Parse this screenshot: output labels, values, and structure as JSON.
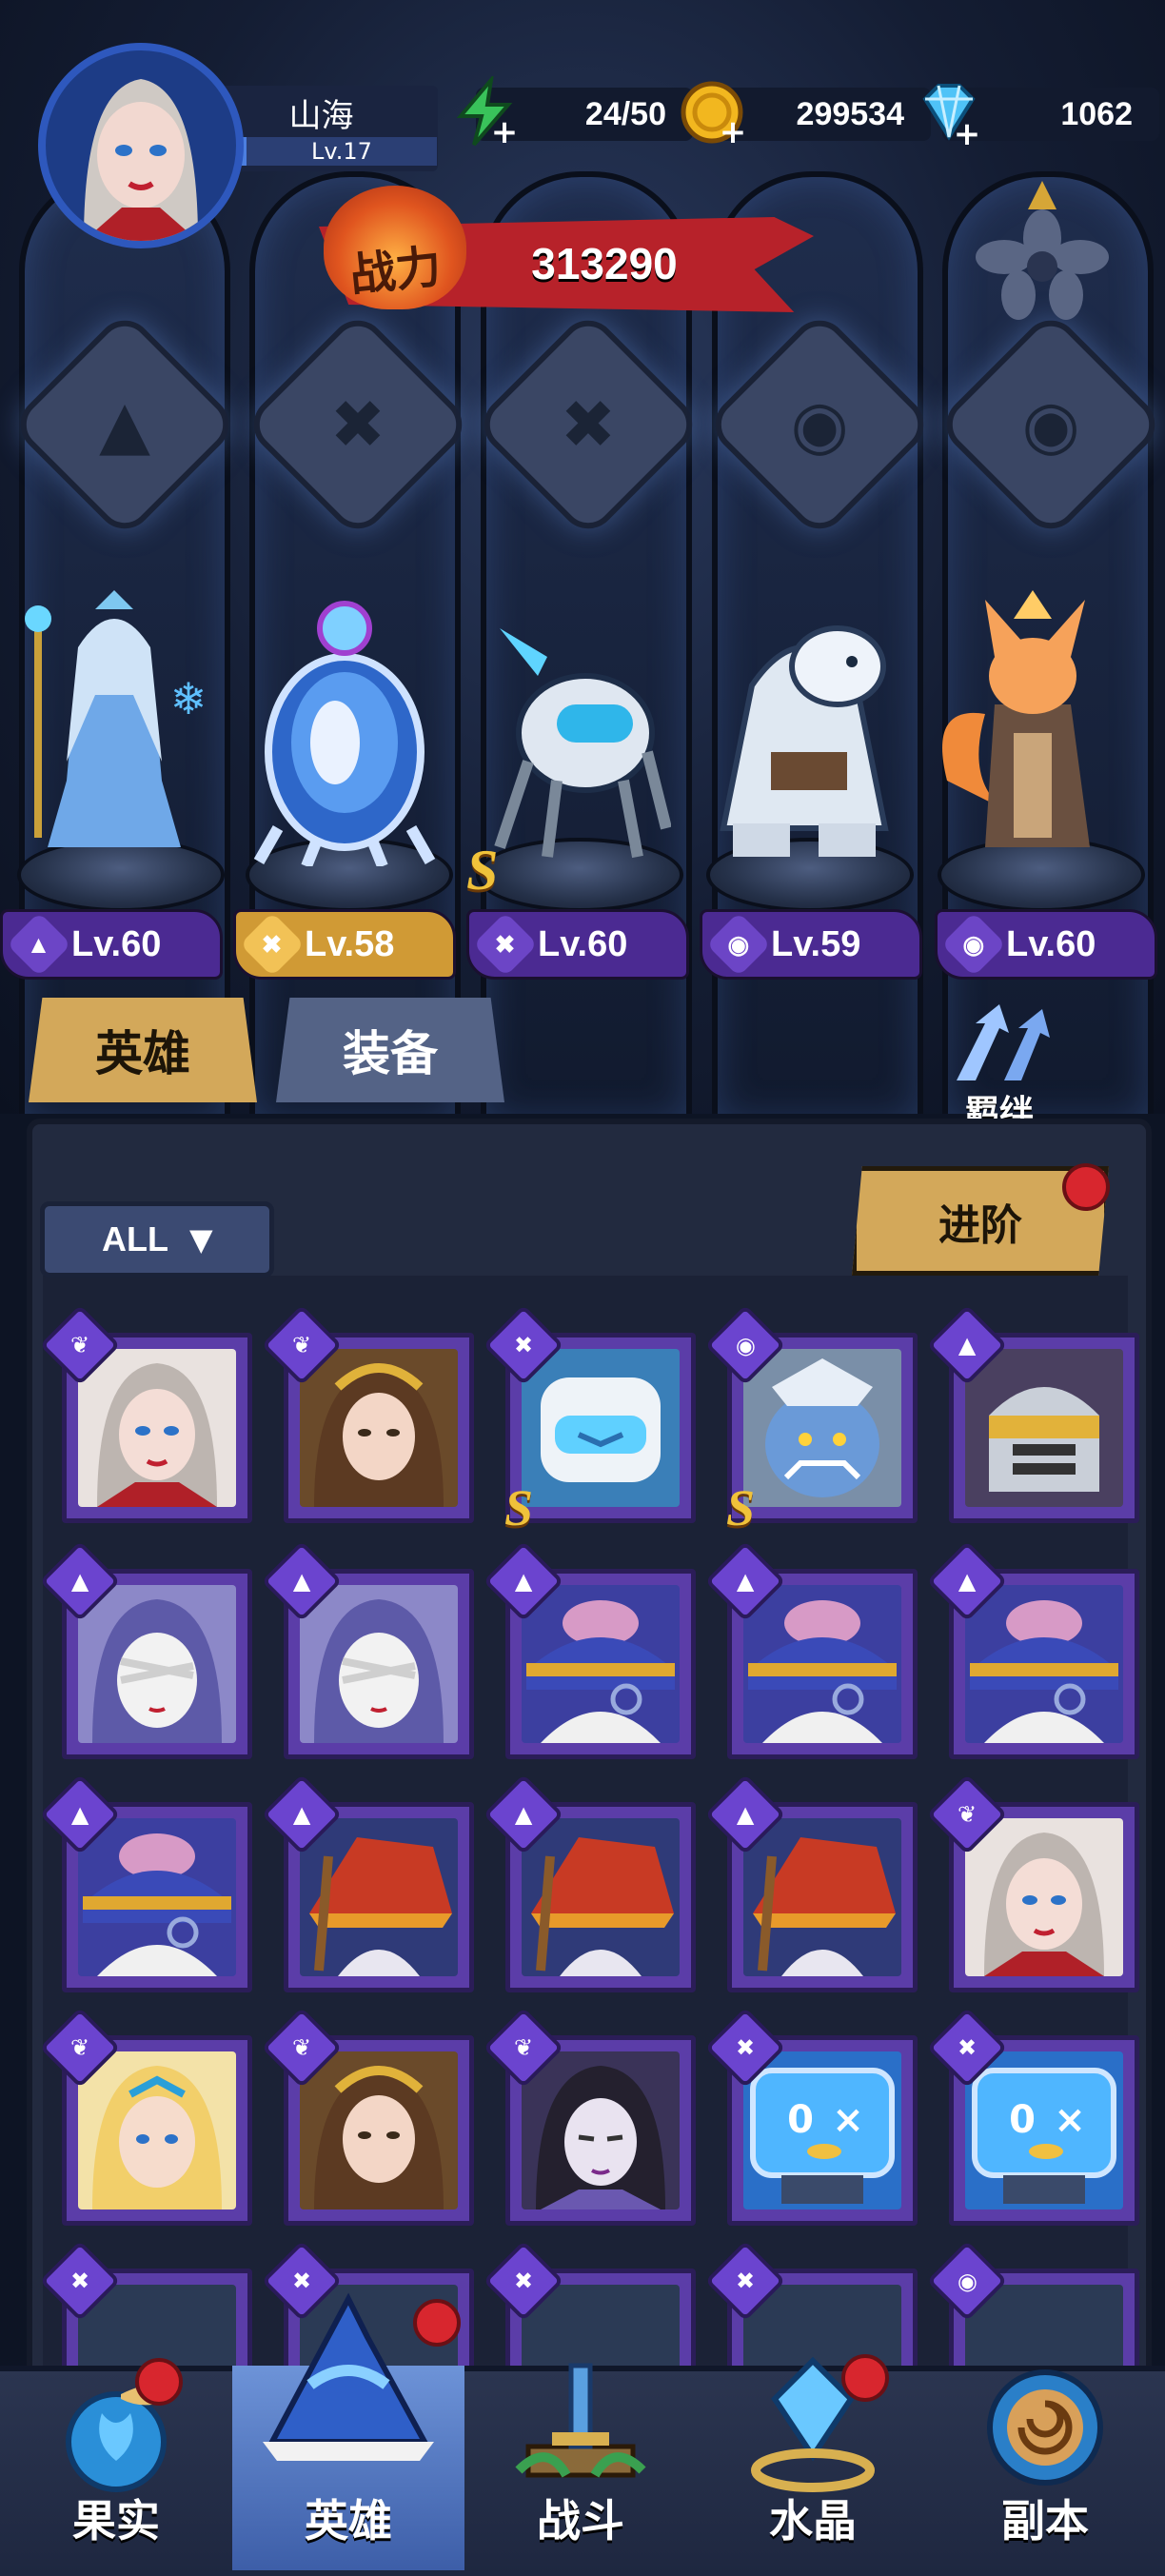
{
  "player": {
    "name": "山海",
    "level": "Lv.17"
  },
  "resources": {
    "energy": "24/50",
    "gold": "299534",
    "gems": "1062"
  },
  "power": {
    "label": "战力",
    "value": "313290"
  },
  "team": [
    {
      "level": "Lv.60",
      "class": "mage-icon"
    },
    {
      "level": "Lv.58",
      "class": "wrench-icon"
    },
    {
      "level": "Lv.60",
      "class": "wrench-icon",
      "rank": "S"
    },
    {
      "level": "Lv.59",
      "class": "beast-icon"
    },
    {
      "level": "Lv.60",
      "class": "beast-icon"
    }
  ],
  "tabs": {
    "heroes": "英雄",
    "equipment": "装备"
  },
  "bond_label": "羁绊",
  "filter": {
    "label": "ALL"
  },
  "advance_label": "进阶",
  "nav": {
    "fruit": "果实",
    "heroes": "英雄",
    "battle": "战斗",
    "crystal": "水晶",
    "dungeon": "副本"
  },
  "colors": {
    "accent_gold": "#d3a85a",
    "tab_inactive": "#546386",
    "card_purple": "#5b3da8",
    "badge_red": "#d8262e"
  }
}
